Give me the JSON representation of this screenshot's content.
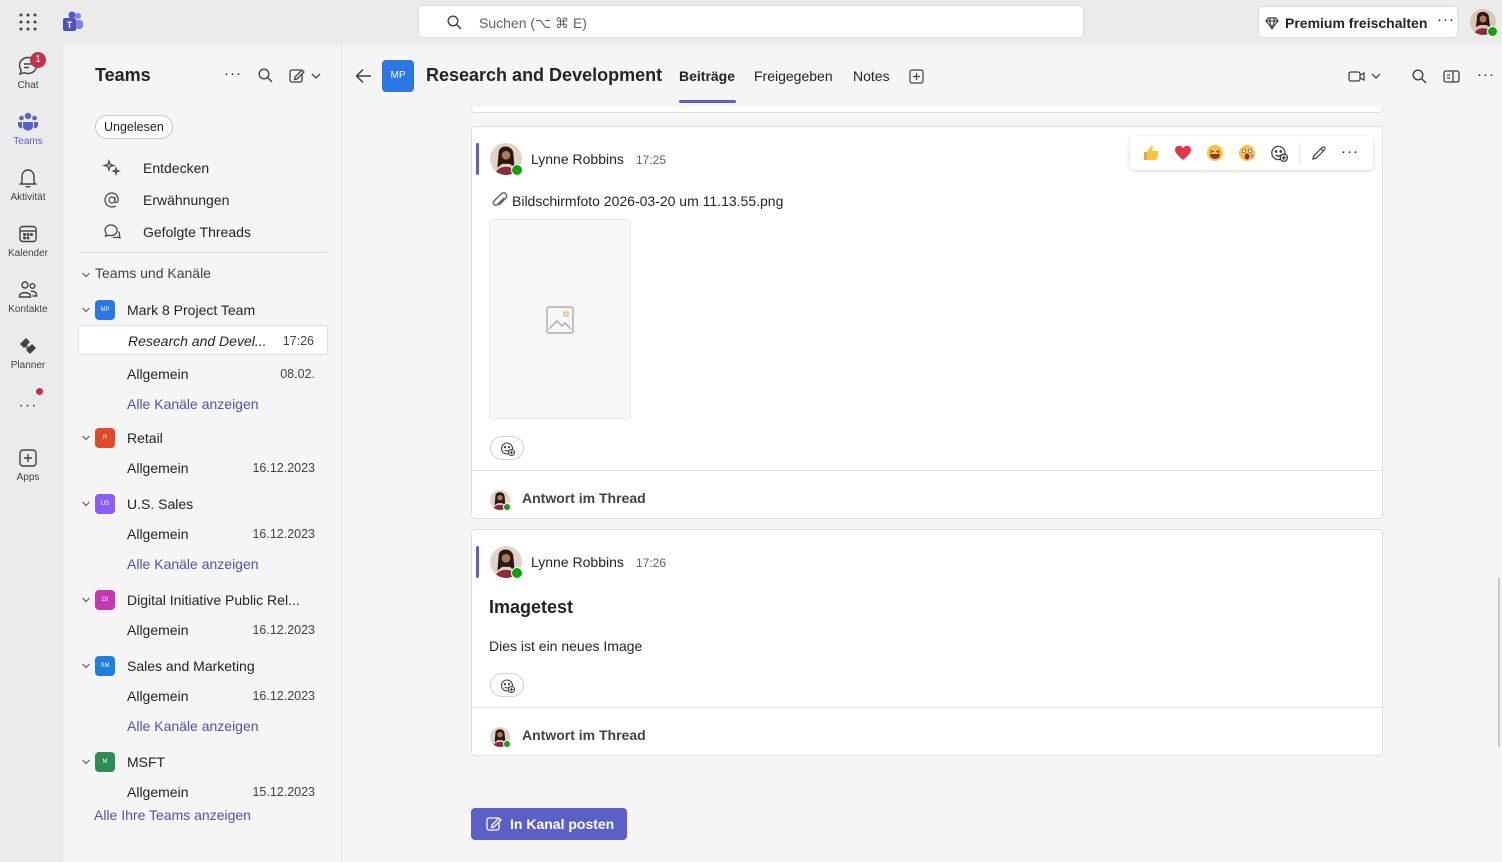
{
  "titlebar": {
    "search_placeholder": "Suchen (⌥ ⌘ E)",
    "premium_label": "Premium freischalten",
    "premium_more": "···"
  },
  "rail": {
    "chat": {
      "label": "Chat",
      "badge": "1"
    },
    "teams": {
      "label": "Teams"
    },
    "activity": {
      "label": "Aktivität"
    },
    "calendar": {
      "label": "Kalender"
    },
    "contacts": {
      "label": "Kontakte"
    },
    "planner": {
      "label": "Planner"
    },
    "more": {
      "label": "···"
    },
    "apps": {
      "label": "Apps"
    }
  },
  "leftpanel": {
    "title": "Teams",
    "filter": "Ungelesen",
    "nav": [
      {
        "label": "Entdecken"
      },
      {
        "label": "Erwähnungen"
      },
      {
        "label": "Gefolgte Threads"
      }
    ],
    "section_title": "Teams und Kanäle",
    "teams": [
      {
        "name": "Mark 8 Project Team",
        "initials": "MP",
        "color": "#2b78e4",
        "channels": [
          {
            "name": "Research and Devel...",
            "time": "17:26",
            "selected": true
          },
          {
            "name": "Allgemein",
            "time": "08.02."
          }
        ],
        "show_all": "Alle Kanäle anzeigen"
      },
      {
        "name": "Retail",
        "initials": "R",
        "color": "#e04a28",
        "channels": [
          {
            "name": "Allgemein",
            "time": "16.12.2023"
          }
        ]
      },
      {
        "name": "U.S. Sales",
        "initials": "US",
        "color": "#8b5cf6",
        "channels": [
          {
            "name": "Allgemein",
            "time": "16.12.2023"
          }
        ],
        "show_all": "Alle Kanäle anzeigen"
      },
      {
        "name": "Digital Initiative Public Rel...",
        "initials": "DI",
        "color": "#c239b3",
        "channels": [
          {
            "name": "Allgemein",
            "time": "16.12.2023"
          }
        ]
      },
      {
        "name": "Sales and Marketing",
        "initials": "SM",
        "color": "#1d7fe0",
        "channels": [
          {
            "name": "Allgemein",
            "time": "16.12.2023"
          }
        ],
        "show_all": "Alle Kanäle anzeigen"
      },
      {
        "name": "MSFT",
        "initials": "M",
        "color": "#2e8b57",
        "channels": [
          {
            "name": "Allgemein",
            "time": "15.12.2023"
          }
        ]
      }
    ],
    "show_all_teams": "Alle Ihre Teams anzeigen"
  },
  "header": {
    "team_initials": "MP",
    "channel_title": "Research and Development",
    "tabs": [
      {
        "label": "Beiträge",
        "active": true
      },
      {
        "label": "Freigegeben"
      },
      {
        "label": "Notes"
      }
    ]
  },
  "messages": [
    {
      "author": "Lynne Robbins",
      "time": "17:25",
      "attachment": "Bildschirmfoto 2026-03-20 um 11.13.55.png",
      "reply_label": "Antwort im Thread"
    },
    {
      "author": "Lynne Robbins",
      "time": "17:26",
      "subject": "Imagetest",
      "body": "Dies ist ein neues Image",
      "reply_label": "Antwort im Thread"
    }
  ],
  "reactions_bar": {
    "emojis": [
      "like-emoji",
      "heart-emoji",
      "laugh-emoji",
      "surprised-emoji"
    ],
    "more": "···"
  },
  "compose": {
    "post_label": "In Kanal posten"
  },
  "colors": {
    "accent": "#5b5fc7",
    "link": "#4f52b2",
    "presence": "#13a10e",
    "badge": "#c4314b"
  }
}
